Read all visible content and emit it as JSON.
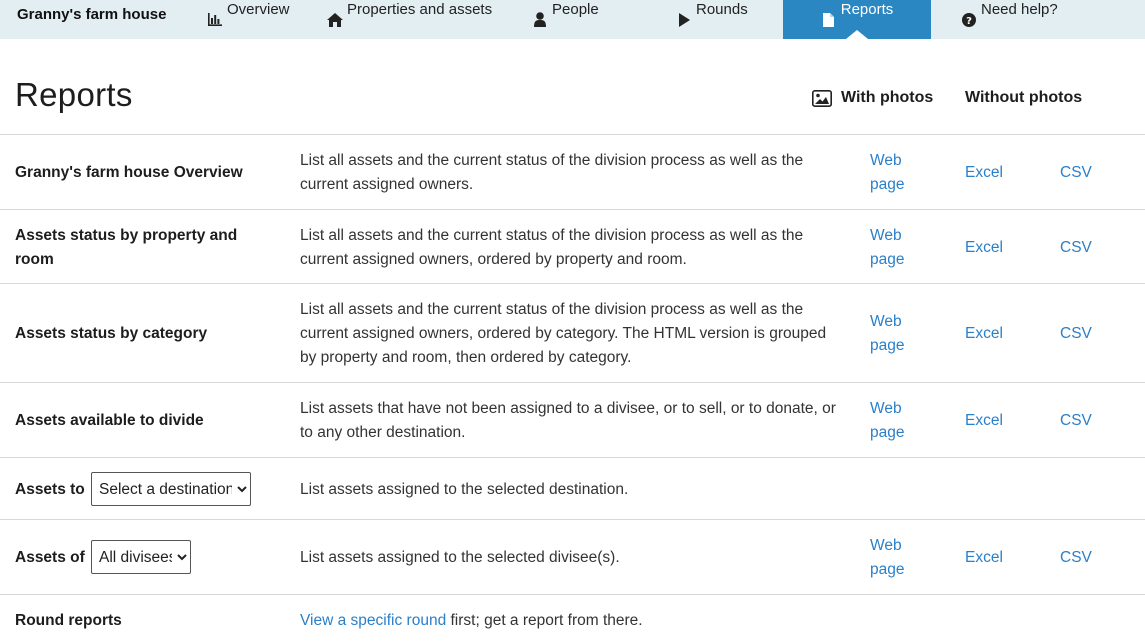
{
  "nav": {
    "brand": "Granny's farm house",
    "items": [
      {
        "label": "Overview",
        "icon": "bar-chart-icon"
      },
      {
        "label": "Properties and assets",
        "icon": "home-icon"
      },
      {
        "label": "People",
        "icon": "person-icon"
      },
      {
        "label": "Rounds",
        "icon": "play-icon"
      },
      {
        "label": "Reports",
        "icon": "document-icon",
        "active": true
      },
      {
        "label": "Need help?",
        "icon": "question-circle-icon"
      }
    ],
    "active_color": "#2b87c2",
    "bar_color": "#e3eef2"
  },
  "page": {
    "title": "Reports",
    "with_photos": "With photos",
    "without_photos": "Without photos"
  },
  "reports": [
    {
      "name": "Granny's farm house Overview",
      "description": "List all assets and the current status of the division process as well as the current assigned owners.",
      "web": "Web page",
      "excel": "Excel",
      "csv": "CSV"
    },
    {
      "name": "Assets status by property and room",
      "description": "List all assets and the current status of the division process as well as the current assigned owners, ordered by property and room.",
      "web": "Web page",
      "excel": "Excel",
      "csv": "CSV"
    },
    {
      "name": "Assets status by category",
      "description": "List all assets and the current status of the division process as well as the current assigned owners, ordered by category. The HTML version is grouped by property and room, then ordered by category.",
      "web": "Web page",
      "excel": "Excel",
      "csv": "CSV"
    },
    {
      "name": "Assets available to divide",
      "description": "List assets that have not been assigned to a divisee, or to sell, or to donate, or to any other destination.",
      "web": "Web page",
      "excel": "Excel",
      "csv": "CSV"
    },
    {
      "name": "Assets to",
      "select_value": "Select a destination",
      "description": "List assets assigned to the selected destination."
    },
    {
      "name": "Assets of",
      "select_value": "All divisees",
      "description": "List assets assigned to the selected divisee(s).",
      "web": "Web page",
      "excel": "Excel",
      "csv": "CSV"
    }
  ],
  "round_reports": {
    "name": "Round reports",
    "link": "View a specific round",
    "suffix": " first; get a report from there."
  },
  "link_color": "#2a7fc9"
}
